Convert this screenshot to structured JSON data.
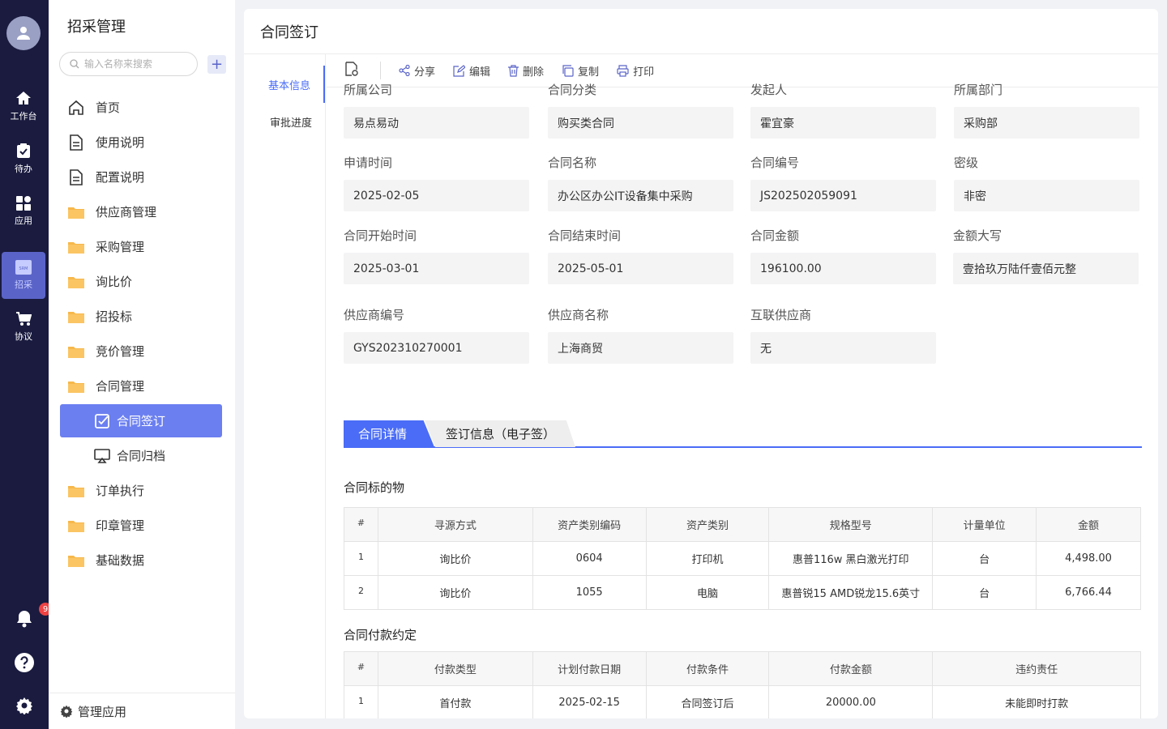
{
  "rail": {
    "items": [
      {
        "label": "工作台",
        "icon": "home-icon"
      },
      {
        "label": "待办",
        "icon": "clipboard-icon"
      },
      {
        "label": "应用",
        "icon": "apps-icon"
      },
      {
        "label": "招采",
        "icon": "srm-icon",
        "logo_text": "SRM"
      },
      {
        "label": "协议",
        "icon": "cart-icon"
      }
    ],
    "notification_count": "9"
  },
  "sidebar": {
    "title": "招采管理",
    "search_placeholder": "输入名称来搜索",
    "add_label": "+",
    "items": [
      {
        "label": "首页",
        "icon": "home-outline-icon"
      },
      {
        "label": "使用说明",
        "icon": "document-icon"
      },
      {
        "label": "配置说明",
        "icon": "document-icon"
      },
      {
        "label": "供应商管理",
        "icon": "folder-icon"
      },
      {
        "label": "采购管理",
        "icon": "folder-icon"
      },
      {
        "label": "询比价",
        "icon": "folder-icon"
      },
      {
        "label": "招投标",
        "icon": "folder-icon"
      },
      {
        "label": "竞价管理",
        "icon": "folder-icon"
      },
      {
        "label": "合同管理",
        "icon": "folder-icon"
      },
      {
        "label": "合同签订",
        "icon": "checkbox-icon"
      },
      {
        "label": "合同归档",
        "icon": "archive-icon"
      },
      {
        "label": "订单执行",
        "icon": "folder-icon"
      },
      {
        "label": "印章管理",
        "icon": "folder-icon"
      },
      {
        "label": "基础数据",
        "icon": "folder-icon"
      }
    ],
    "footer_label": "管理应用"
  },
  "main": {
    "title": "合同签订",
    "vtabs": [
      "基本信息",
      "审批进度"
    ],
    "toolbar": {
      "share": "分享",
      "edit": "编辑",
      "delete": "删除",
      "copy": "复制",
      "print": "打印"
    },
    "fields": [
      {
        "label": "所属公司",
        "value": "易点易动"
      },
      {
        "label": "合同分类",
        "value": "购买类合同"
      },
      {
        "label": "发起人",
        "value": "霍宜豪"
      },
      {
        "label": "所属部门",
        "value": "采购部"
      },
      {
        "label": "申请时间",
        "value": "2025-02-05"
      },
      {
        "label": "合同名称",
        "value": "办公区办公IT设备集中采购"
      },
      {
        "label": "合同编号",
        "value": "JS202502059091"
      },
      {
        "label": "密级",
        "value": "非密"
      },
      {
        "label": "合同开始时间",
        "value": "2025-03-01"
      },
      {
        "label": "合同结束时间",
        "value": "2025-05-01"
      },
      {
        "label": "合同金额",
        "value": "196100.00"
      },
      {
        "label": "金额大写",
        "value": "壹拾玖万陆仟壹佰元整"
      },
      {
        "label": "供应商编号",
        "value": "GYS202310270001"
      },
      {
        "label": "供应商名称",
        "value": "上海商贸"
      },
      {
        "label": "互联供应商",
        "value": "无"
      }
    ],
    "tabs": [
      "合同详情",
      "签订信息（电子签）"
    ],
    "items_section": {
      "title": "合同标的物",
      "headers": [
        "#",
        "寻源方式",
        "资产类别编码",
        "资产类别",
        "规格型号",
        "计量单位",
        "金额"
      ],
      "rows": [
        [
          "1",
          "询比价",
          "0604",
          "打印机",
          "惠普116w 黑白激光打印",
          "台",
          "4,498.00"
        ],
        [
          "2",
          "询比价",
          "1055",
          "电脑",
          "惠普锐15 AMD锐龙15.6英寸",
          "台",
          "6,766.44"
        ]
      ]
    },
    "payment_section": {
      "title": "合同付款约定",
      "headers": [
        "#",
        "付款类型",
        "计划付款日期",
        "付款条件",
        "付款金额",
        "违约责任"
      ],
      "rows": [
        [
          "1",
          "首付款",
          "2025-02-15",
          "合同签订后",
          "20000.00",
          "未能即时打款"
        ]
      ]
    }
  }
}
